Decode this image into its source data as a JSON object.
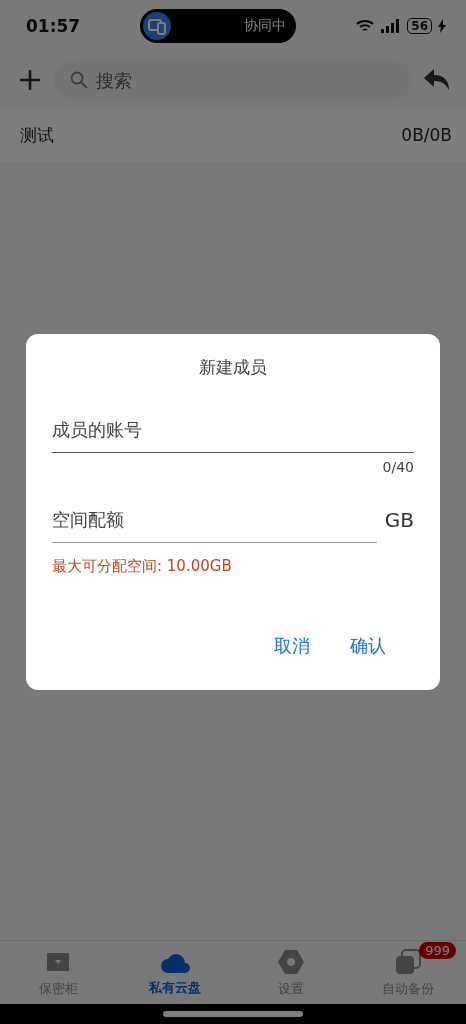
{
  "status_bar": {
    "time": "01:57",
    "pill_label": "协同中",
    "battery": "56"
  },
  "toolbar": {
    "search": {
      "placeholder": "搜索"
    }
  },
  "list": [
    {
      "name": "测试",
      "usage": "0B/0B"
    }
  ],
  "dialog": {
    "title": "新建成员",
    "fields": [
      {
        "kind": "account",
        "placeholder": "成员的账号",
        "counter": "0/40"
      },
      {
        "kind": "quota",
        "placeholder": "空间配额",
        "unit": "GB"
      }
    ],
    "hint": "最大可分配空间: 10.00GB",
    "buttons": [
      "取消",
      "确认"
    ]
  },
  "tabs": [
    {
      "label": "保密柜",
      "kind": "chest",
      "selected": false
    },
    {
      "label": "私有云盘",
      "kind": "cloud",
      "selected": true
    },
    {
      "label": "设置",
      "kind": "gear",
      "selected": false
    },
    {
      "label": "自动备份",
      "kind": "stack",
      "selected": false,
      "badge": "999"
    }
  ]
}
